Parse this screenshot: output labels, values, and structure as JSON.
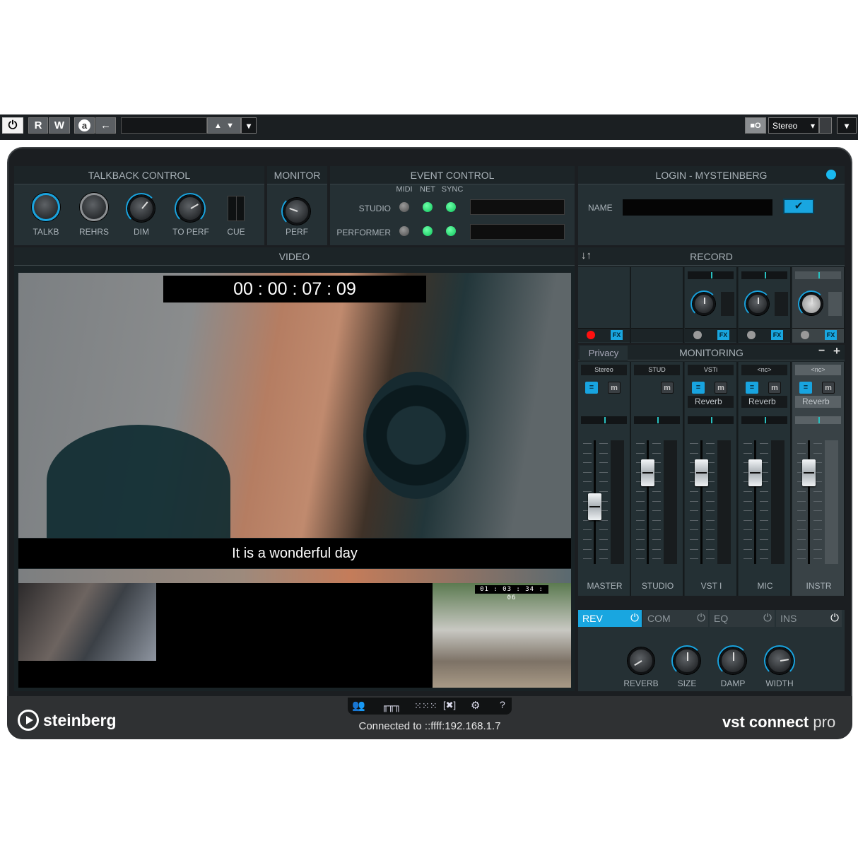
{
  "toolbar": {
    "power_icon": "power-icon",
    "read_label": "R",
    "write_label": "W",
    "auto_label": "a",
    "back_label": "←",
    "preset_value": "",
    "up_label": "▲",
    "down_label": "▼",
    "menu_arrow": "▾",
    "camera_label": "■O",
    "output_select": "Stereo",
    "output_arrow": "▾",
    "right_arrow": "▾"
  },
  "talkback": {
    "title": "TALKBACK CONTROL",
    "knobs": [
      {
        "label": "TALKB"
      },
      {
        "label": "REHRS"
      },
      {
        "label": "DIM"
      },
      {
        "label": "TO PERF"
      },
      {
        "label": "CUE"
      }
    ]
  },
  "monitor": {
    "title": "MONITOR",
    "knob_label": "PERF"
  },
  "event": {
    "title": "EVENT CONTROL",
    "cols": [
      "MIDI",
      "NET",
      "SYNC"
    ],
    "rows": [
      {
        "label": "STUDIO",
        "midi": "off",
        "net": "on",
        "sync": "on"
      },
      {
        "label": "PERFORMER",
        "midi": "off",
        "net": "on",
        "sync": "on"
      }
    ]
  },
  "login": {
    "title": "LOGIN - MYSTEINBERG",
    "name_label": "NAME",
    "name_value": "",
    "confirm": "✔",
    "status_color": "#19b9f0"
  },
  "video": {
    "title": "VIDEO",
    "timecode": "00 : 00 : 07 : 09",
    "subtitle": "It is a wonderful day",
    "pip_timecode": "01 : 03 : 34 : 06"
  },
  "record": {
    "title": "RECORD",
    "sort_icon": "↓↑",
    "fx_label": "FX"
  },
  "monitoring": {
    "title": "MONITORING",
    "privacy": "Privacy",
    "minus": "−",
    "plus": "+",
    "channels": [
      {
        "name": "Stereo",
        "label": "MASTER",
        "send": "",
        "bus": true,
        "fader": 0.45
      },
      {
        "name": "STUD",
        "label": "STUDIO",
        "send": "",
        "bus": false,
        "fader": 0.8
      },
      {
        "name": "VSTi",
        "label": "VST I",
        "send": "Reverb",
        "bus": true,
        "fader": 0.8
      },
      {
        "name": "<nc>",
        "label": "MIC",
        "send": "Reverb",
        "bus": true,
        "fader": 0.8
      },
      {
        "name": "<nc>",
        "label": "INSTR",
        "send": "Reverb",
        "bus": true,
        "fader": 0.8
      }
    ],
    "mute_label": "m",
    "bus_label": "≡"
  },
  "fx": {
    "tabs": [
      {
        "label": "REV",
        "active": true
      },
      {
        "label": "COM",
        "active": false
      },
      {
        "label": "EQ",
        "active": false
      },
      {
        "label": "INS",
        "active": false
      }
    ],
    "knobs": [
      {
        "label": "REVERB",
        "value": 0.05
      },
      {
        "label": "SIZE",
        "value": 0.5
      },
      {
        "label": "DAMP",
        "value": 0.5
      },
      {
        "label": "WIDTH",
        "value": 0.8
      }
    ],
    "power": "⏻"
  },
  "footer": {
    "brand": "steinberg",
    "status": "Connected to ::ffff:192.168.1.7",
    "product_bold": "vst connect",
    "product_light": " pro",
    "icons": [
      "users-icon",
      "routing-icon",
      "mixer-icon",
      "fullscreen-icon",
      "settings-icon",
      "help-icon"
    ],
    "help": "?",
    "gear": "⚙"
  },
  "accent": "#19a6e0"
}
